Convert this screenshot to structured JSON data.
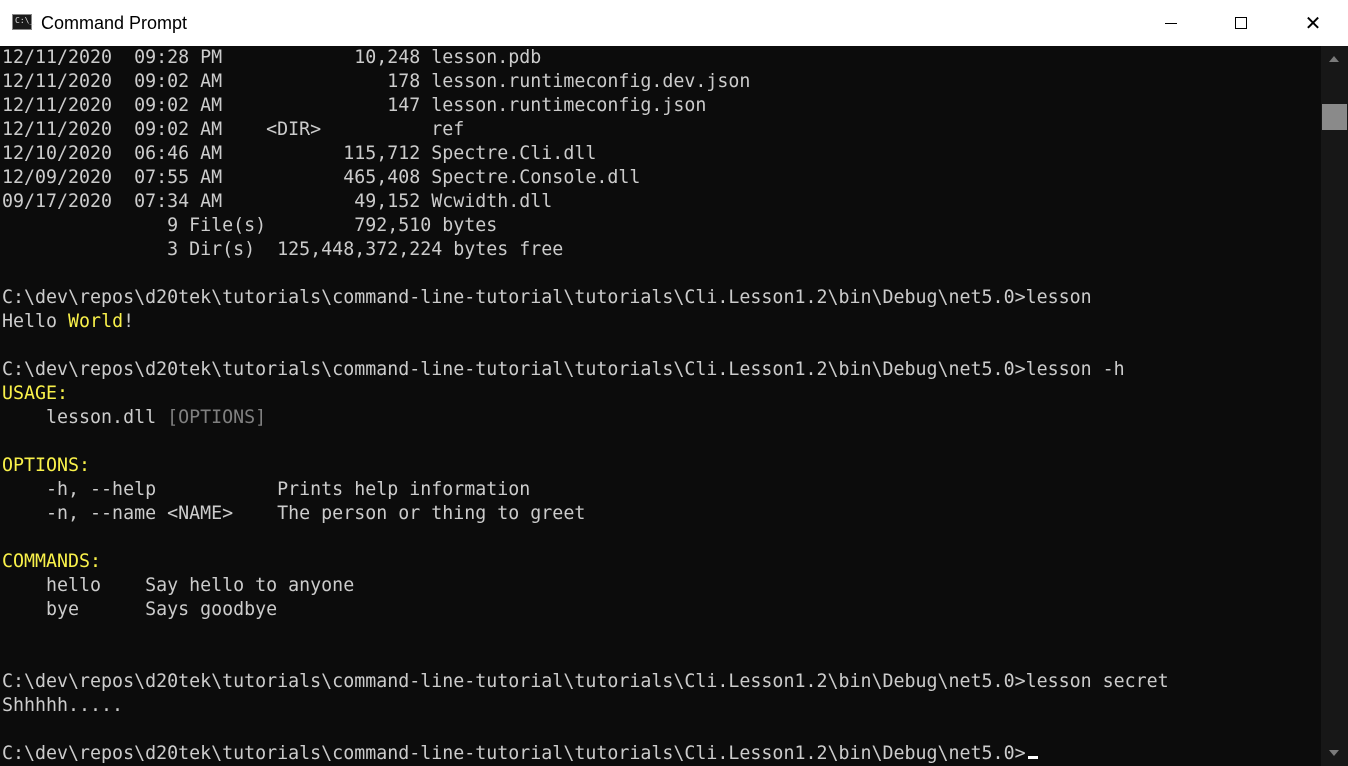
{
  "window": {
    "title": "Command Prompt",
    "icon_text": "C:\\_",
    "controls": {
      "minimize": "minimize-icon",
      "maximize": "maximize-icon",
      "close": "close-icon",
      "close_glyph": "✕"
    }
  },
  "console": {
    "dir_listing": [
      "12/11/2020  09:28 PM            10,248 lesson.pdb",
      "12/11/2020  09:02 AM               178 lesson.runtimeconfig.dev.json",
      "12/11/2020  09:02 AM               147 lesson.runtimeconfig.json",
      "12/11/2020  09:02 AM    <DIR>          ref",
      "12/10/2020  06:46 AM           115,712 Spectre.Cli.dll",
      "12/09/2020  07:55 AM           465,408 Spectre.Console.dll",
      "09/17/2020  07:34 AM            49,152 Wcwidth.dll",
      "               9 File(s)        792,510 bytes",
      "               3 Dir(s)  125,448,372,224 bytes free"
    ],
    "prompt": "C:\\dev\\repos\\d20tek\\tutorials\\command-line-tutorial\\tutorials\\Cli.Lesson1.2\\bin\\Debug\\net5.0>",
    "cmd1": "lesson",
    "hello_prefix": "Hello ",
    "hello_world": "World",
    "hello_suffix": "!",
    "cmd2": "lesson -h",
    "usage_header": "USAGE:",
    "usage_line": "    lesson.dll ",
    "usage_options": "[OPTIONS]",
    "options_header": "OPTIONS:",
    "options": [
      "    -h, --help           Prints help information",
      "    -n, --name <NAME>    The person or thing to greet"
    ],
    "commands_header": "COMMANDS:",
    "commands": [
      "    hello    Say hello to anyone",
      "    bye      Says goodbye"
    ],
    "cmd3": "lesson secret",
    "secret_output": "Shhhhh.....",
    "colors": {
      "background": "#0c0c0c",
      "text": "#cccccc",
      "yellow": "#f9f1a5",
      "gray": "#808080"
    }
  },
  "scrollbar": {
    "up": "scroll-up-arrow-icon",
    "down": "scroll-down-arrow-icon"
  }
}
